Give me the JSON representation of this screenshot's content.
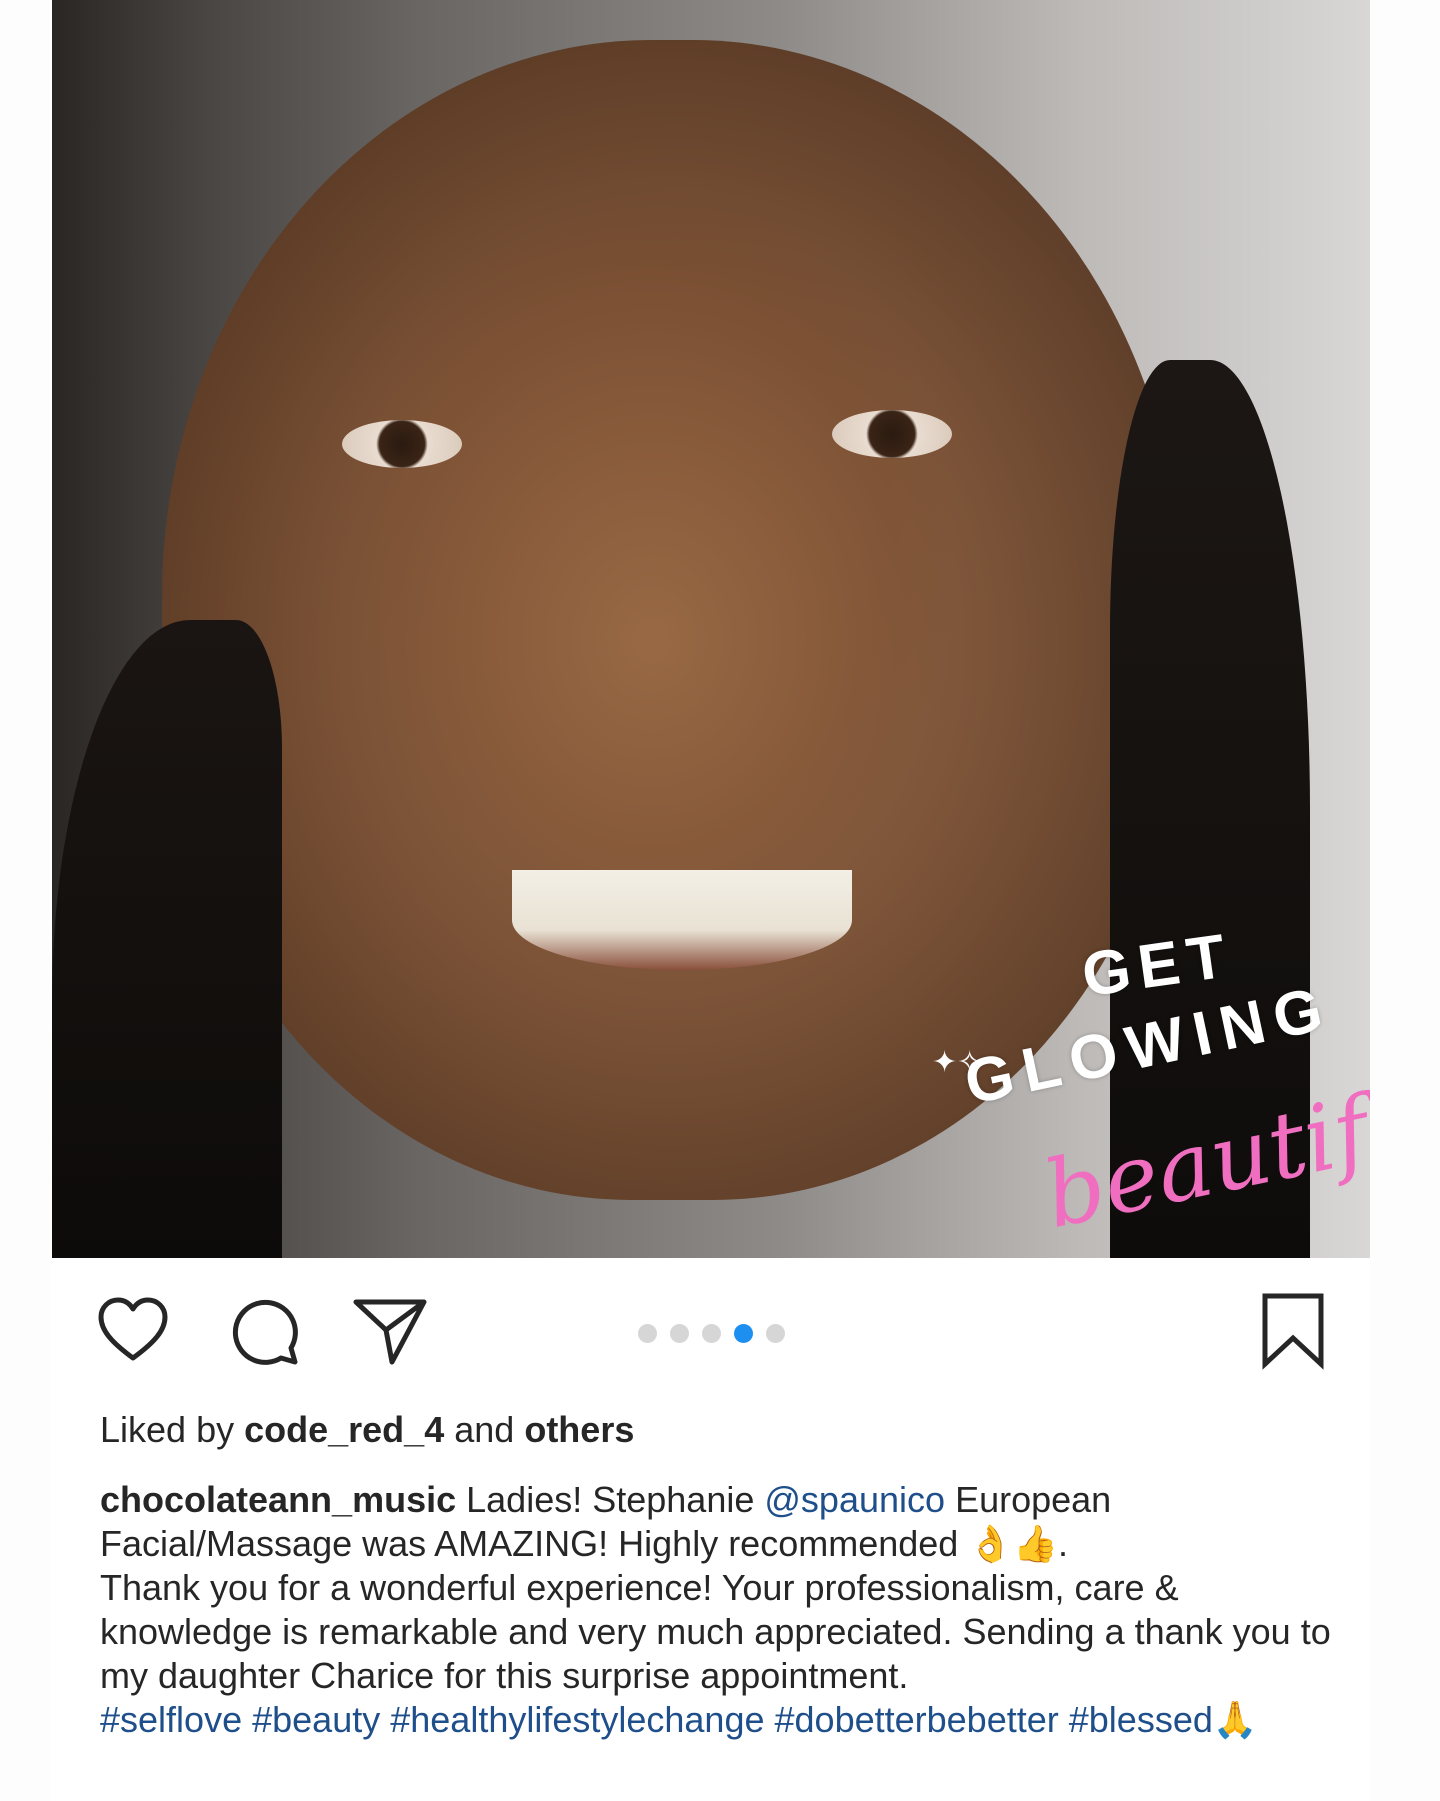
{
  "photo": {
    "overlay_line1": "GET",
    "overlay_line2": "GLOWING",
    "overlay_line3": "beautiful",
    "overlay_script_color": "#f06ec0"
  },
  "actions": {
    "icons": [
      "heart-icon",
      "comment-icon",
      "share-icon",
      "bookmark-icon"
    ],
    "carousel": {
      "count": 5,
      "active_index": 3,
      "active_color": "#1d8ff0"
    }
  },
  "likes": {
    "prefix": "Liked by",
    "user": "code_red_4",
    "and": "and",
    "others": "others"
  },
  "caption": {
    "username": "chocolateann_music",
    "text1": "Ladies! Stephanie",
    "mention": "@spaunico",
    "text2": "European Facial/Massage was AMAZING! Highly recommended 👌👍.",
    "text3": "Thank you for a wonderful experience! Your professionalism, care & knowledge is remarkable and very much appreciated. Sending a thank you to my daughter Charice for this surprise appointment.",
    "hashtags": [
      "#selflove",
      "#beauty",
      "#healthylifestylechange",
      "#dobetterbebetter",
      "#blessed"
    ],
    "trailing_emoji": "🙏"
  }
}
